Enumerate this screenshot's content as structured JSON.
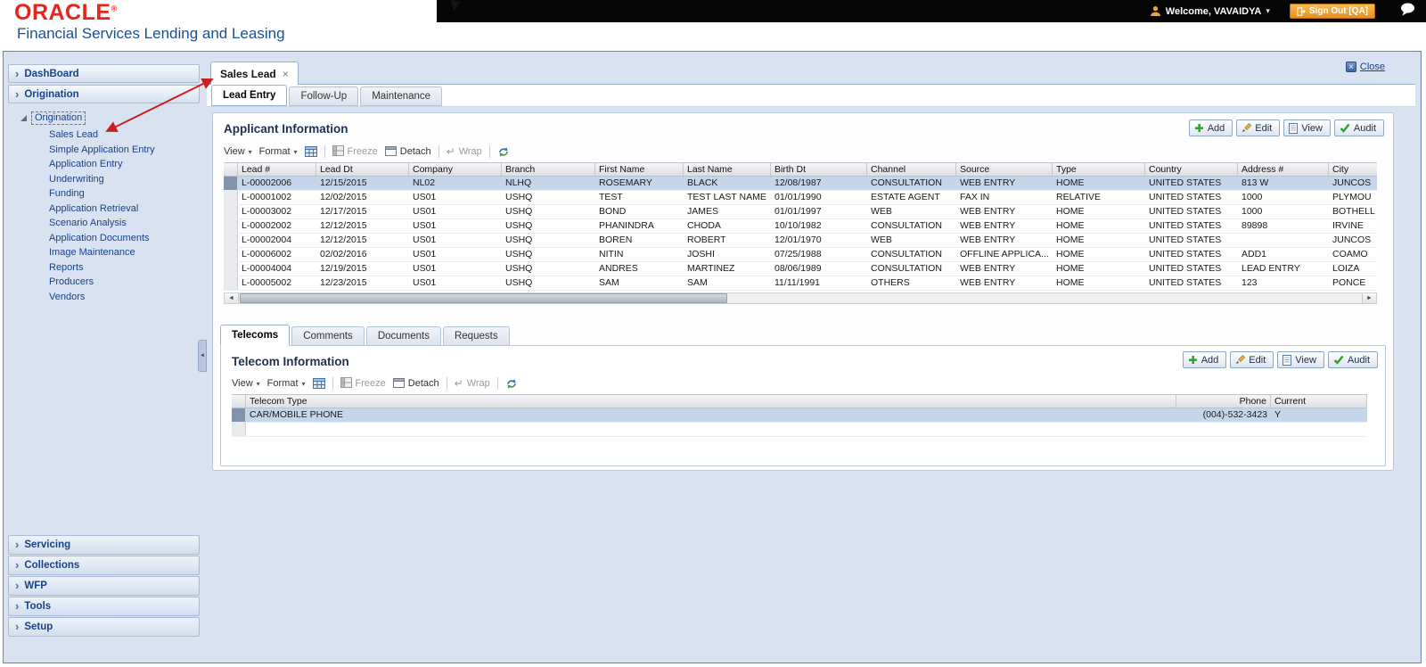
{
  "header": {
    "logo": "ORACLE",
    "registered": "®",
    "subtitle": "Financial Services Lending and Leasing",
    "welcome": "Welcome, VAVAIDYA",
    "sign_out": "Sign Out [QA]"
  },
  "icons": {
    "chevron_right": "›",
    "caret_down": "▾",
    "close_x": "×",
    "scroll_left": "◄",
    "scroll_right": "►",
    "collapse_left": "◄",
    "wrap_arrow": "↵"
  },
  "sidebar": {
    "top_sections": [
      "DashBoard",
      "Origination"
    ],
    "tree": {
      "root": "Origination",
      "items": [
        "Sales Lead",
        "Simple Application Entry",
        "Application Entry",
        "Underwriting",
        "Funding",
        "Application Retrieval",
        "Scenario Analysis",
        "Application Documents",
        "Image Maintenance",
        "Reports",
        "Producers",
        "Vendors"
      ],
      "selected": "Sales Lead"
    },
    "bottom_sections": [
      "Servicing",
      "Collections",
      "WFP",
      "Tools",
      "Setup"
    ]
  },
  "main": {
    "window_tab": "Sales Lead",
    "close_label": "Close",
    "tabs": [
      "Lead Entry",
      "Follow-Up",
      "Maintenance"
    ],
    "active_tab": "Lead Entry",
    "applicant": {
      "title": "Applicant Information",
      "actions": [
        "Add",
        "Edit",
        "View",
        "Audit"
      ],
      "toolbar": {
        "view": "View",
        "format": "Format",
        "freeze": "Freeze",
        "detach": "Detach",
        "wrap": "Wrap"
      },
      "columns": [
        "Lead #",
        "Lead Dt",
        "Company",
        "Branch",
        "First Name",
        "Last Name",
        "Birth Dt",
        "Channel",
        "Source",
        "Type",
        "Country",
        "Address #",
        "City"
      ],
      "rows": [
        [
          "L-00002006",
          "12/15/2015",
          "NL02",
          "NLHQ",
          "ROSEMARY",
          "BLACK",
          "12/08/1987",
          "CONSULTATION",
          "WEB ENTRY",
          "HOME",
          "UNITED STATES",
          "813 W",
          "JUNCOS"
        ],
        [
          "L-00001002",
          "12/02/2015",
          "US01",
          "USHQ",
          "TEST",
          "TEST LAST NAME",
          "01/01/1990",
          "ESTATE AGENT",
          "FAX IN",
          "RELATIVE",
          "UNITED STATES",
          "1000",
          "PLYMOU"
        ],
        [
          "L-00003002",
          "12/17/2015",
          "US01",
          "USHQ",
          "BOND",
          "JAMES",
          "01/01/1997",
          "WEB",
          "WEB ENTRY",
          "HOME",
          "UNITED STATES",
          "1000",
          "BOTHELL"
        ],
        [
          "L-00002002",
          "12/12/2015",
          "US01",
          "USHQ",
          "PHANINDRA",
          "CHODA",
          "10/10/1982",
          "CONSULTATION",
          "WEB ENTRY",
          "HOME",
          "UNITED STATES",
          "89898",
          "IRVINE"
        ],
        [
          "L-00002004",
          "12/12/2015",
          "US01",
          "USHQ",
          "BOREN",
          "ROBERT",
          "12/01/1970",
          "WEB",
          "WEB ENTRY",
          "HOME",
          "UNITED STATES",
          "",
          "JUNCOS"
        ],
        [
          "L-00006002",
          "02/02/2016",
          "US01",
          "USHQ",
          "NITIN",
          "JOSHI",
          "07/25/1988",
          "CONSULTATION",
          "OFFLINE APPLICA...",
          "HOME",
          "UNITED STATES",
          "ADD1",
          "COAMO"
        ],
        [
          "L-00004004",
          "12/19/2015",
          "US01",
          "USHQ",
          "ANDRES",
          "MARTINEZ",
          "08/06/1989",
          "CONSULTATION",
          "WEB ENTRY",
          "HOME",
          "UNITED STATES",
          "LEAD ENTRY",
          "LOIZA"
        ],
        [
          "L-00005002",
          "12/23/2015",
          "US01",
          "USHQ",
          "SAM",
          "SAM",
          "11/11/1991",
          "OTHERS",
          "WEB ENTRY",
          "HOME",
          "UNITED STATES",
          "123",
          "PONCE"
        ]
      ],
      "selected_row": 0
    },
    "detail_tabs": [
      "Telecoms",
      "Comments",
      "Documents",
      "Requests"
    ],
    "active_detail_tab": "Telecoms",
    "telecom": {
      "title": "Telecom Information",
      "actions": [
        "Add",
        "Edit",
        "View",
        "Audit"
      ],
      "toolbar": {
        "view": "View",
        "format": "Format",
        "freeze": "Freeze",
        "detach": "Detach",
        "wrap": "Wrap"
      },
      "columns": [
        "Telecom Type",
        "Phone",
        "Current"
      ],
      "rows": [
        [
          "CAR/MOBILE PHONE",
          "(004)-532-3423",
          "Y"
        ]
      ],
      "selected_row": 0
    }
  }
}
